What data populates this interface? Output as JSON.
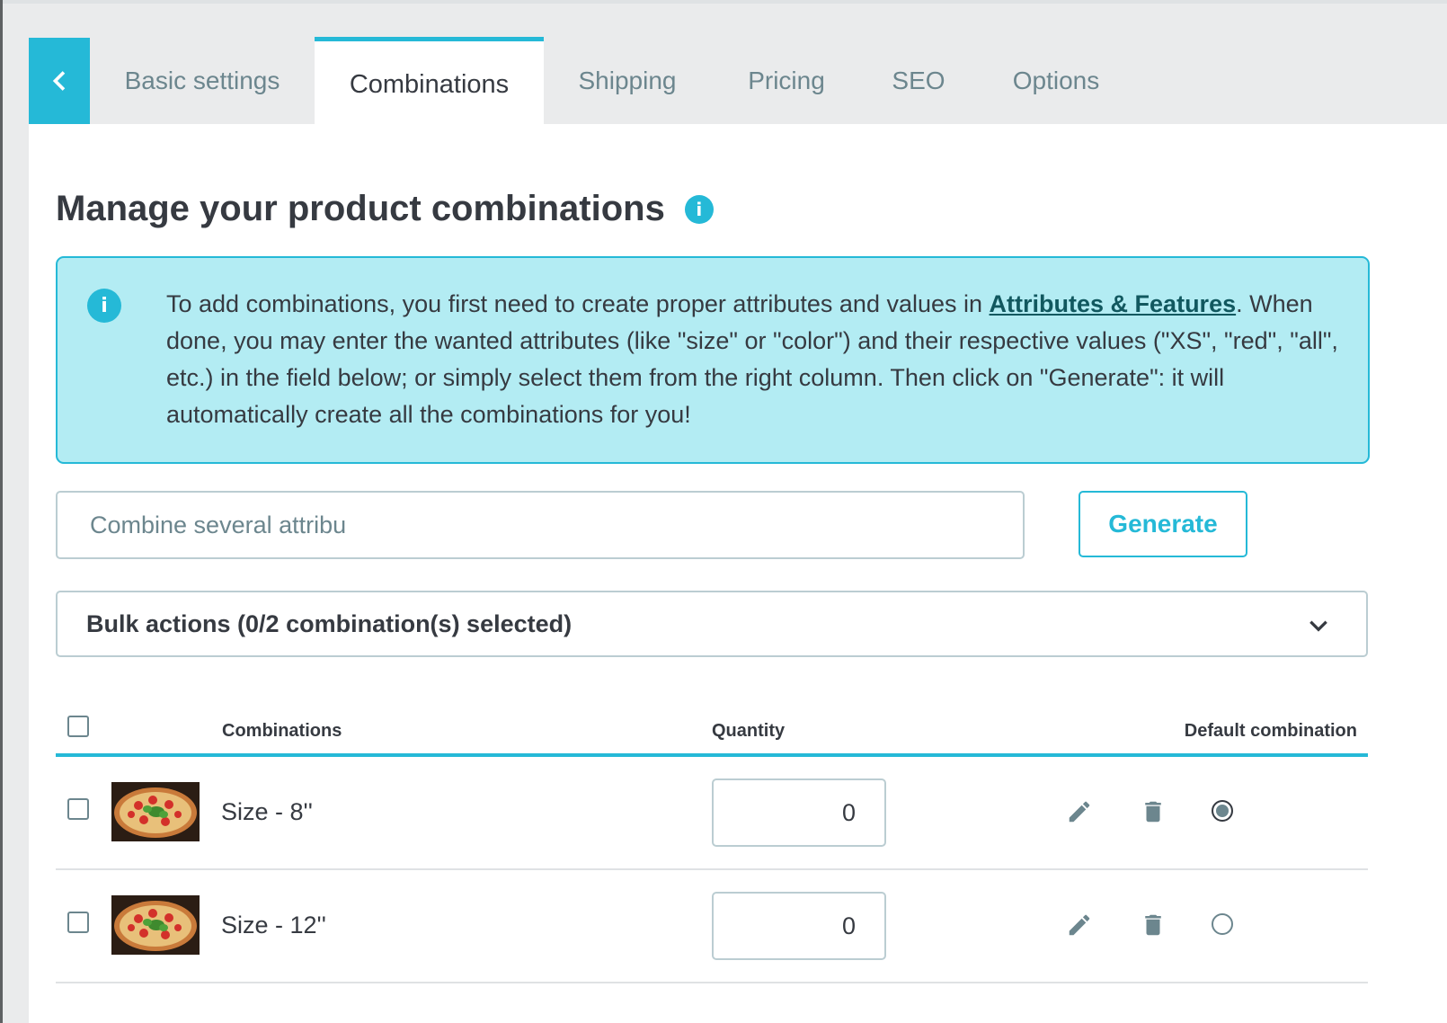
{
  "tabs": {
    "back_icon": "chevron-left-icon",
    "items": [
      {
        "label": "Basic settings",
        "active": false
      },
      {
        "label": "Combinations",
        "active": true
      },
      {
        "label": "Shipping",
        "active": false
      },
      {
        "label": "Pricing",
        "active": false
      },
      {
        "label": "SEO",
        "active": false
      },
      {
        "label": "Options",
        "active": false
      }
    ]
  },
  "page": {
    "title": "Manage your product combinations",
    "title_icon": "info-icon"
  },
  "alert": {
    "icon": "info-icon",
    "text_before_link": "To add combinations, you first need to create proper attributes and values in ",
    "link_text": "Attributes & Features",
    "text_after_link": ". When done, you may enter the wanted attributes (like \"size\" or \"color\") and their respective values (\"XS\", \"red\", \"all\", etc.) in the field below; or simply select them from the right column. Then click on \"Generate\": it will automatically create all the combinations for you!"
  },
  "combine": {
    "placeholder": "Combine several attribu",
    "generate_label": "Generate"
  },
  "bulk": {
    "label": "Bulk actions (0/2 combination(s) selected)",
    "icon": "chevron-down-icon"
  },
  "table": {
    "headers": {
      "combinations": "Combinations",
      "quantity": "Quantity",
      "default": "Default combination"
    },
    "rows": [
      {
        "label": "Size - 8''",
        "quantity": "0",
        "default": true,
        "checked": false
      },
      {
        "label": "Size - 12''",
        "quantity": "0",
        "default": false,
        "checked": false
      }
    ]
  },
  "colors": {
    "accent": "#25b9d7",
    "alert_bg": "#b3ecf3",
    "text": "#363a41",
    "muted": "#6c868e"
  }
}
